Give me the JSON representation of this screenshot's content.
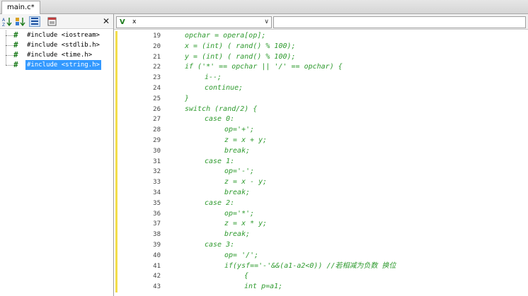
{
  "tabs": [
    {
      "label": "main.c*"
    }
  ],
  "left_panel": {
    "close_glyph": "✕",
    "includes": [
      {
        "text": "#include <iostream>",
        "selected": false
      },
      {
        "text": "#include <stdlib.h>",
        "selected": false
      },
      {
        "text": "#include <time.h>",
        "selected": false
      },
      {
        "text": "#include <string.h>",
        "selected": true
      }
    ]
  },
  "editor": {
    "combo_symbol": "x",
    "lines": [
      {
        "n": "19",
        "indent": 0,
        "code": "opchar = opera[op];"
      },
      {
        "n": "20",
        "indent": 0,
        "code": "x = (int) ( rand() % 100);"
      },
      {
        "n": "21",
        "indent": 0,
        "code": "y = (int) ( rand() % 100);"
      },
      {
        "n": "22",
        "indent": 0,
        "code": "if ('*' == opchar || '/' == opchar) {"
      },
      {
        "n": "23",
        "indent": 1,
        "code": "i--;"
      },
      {
        "n": "24",
        "indent": 1,
        "code": "continue;"
      },
      {
        "n": "25",
        "indent": 0,
        "code": "}"
      },
      {
        "n": "26",
        "indent": 0,
        "code": "switch (rand/2) {"
      },
      {
        "n": "27",
        "indent": 1,
        "code": "case 0:"
      },
      {
        "n": "28",
        "indent": 2,
        "code": "op='+';"
      },
      {
        "n": "29",
        "indent": 2,
        "code": "z = x + y;"
      },
      {
        "n": "30",
        "indent": 2,
        "code": "break;"
      },
      {
        "n": "31",
        "indent": 1,
        "code": "case 1:"
      },
      {
        "n": "32",
        "indent": 2,
        "code": "op='-';"
      },
      {
        "n": "33",
        "indent": 2,
        "code": "z = x - y;"
      },
      {
        "n": "34",
        "indent": 2,
        "code": "break;"
      },
      {
        "n": "35",
        "indent": 1,
        "code": "case 2:"
      },
      {
        "n": "36",
        "indent": 2,
        "code": "op='*';"
      },
      {
        "n": "37",
        "indent": 2,
        "code": "z = x * y;"
      },
      {
        "n": "38",
        "indent": 2,
        "code": "break;"
      },
      {
        "n": "39",
        "indent": 1,
        "code": "case 3:"
      },
      {
        "n": "40",
        "indent": 2,
        "code": "op= '/';"
      },
      {
        "n": "41",
        "indent": 2,
        "code": "if(ysf=='-'&&(a1-a2<0)) //若相减为负数 换位"
      },
      {
        "n": "42",
        "indent": 3,
        "code": "{"
      },
      {
        "n": "43",
        "indent": 3,
        "code": "int p=a1;"
      }
    ]
  },
  "colors": {
    "code": "#2e9a2e",
    "selection": "#3399ff",
    "change_marker": "#f2dd4a"
  }
}
